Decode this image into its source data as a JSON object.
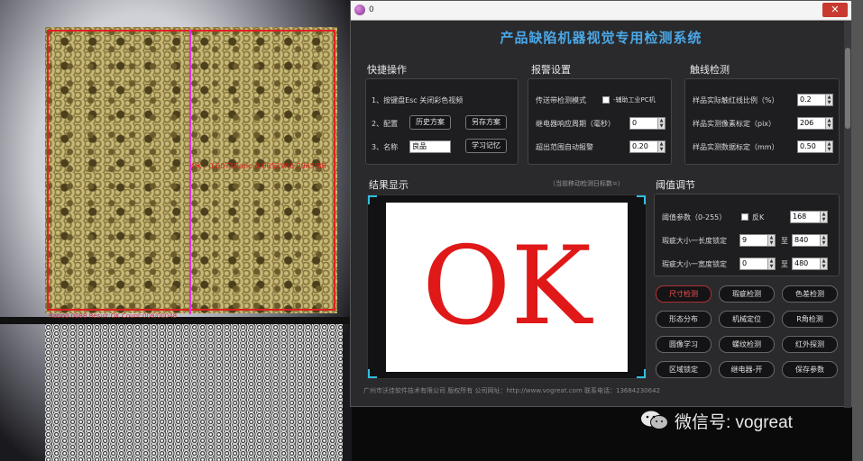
{
  "camera": {
    "readout": "OK - 0.0071Ratio:0.0052W:0.0045/88",
    "caption": "Ratio0.0088 Result:OK Count:008/00048"
  },
  "window": {
    "title": "0",
    "close_label": "✕",
    "header": "产品缺陷机器视觉专用检测系统"
  },
  "quick": {
    "label": "快捷操作",
    "line1": "1、按键盘Esc 关闭彩色视频",
    "line2": "2、配置",
    "history_btn": "历史方案",
    "saveas_btn": "另存方案",
    "line3": "3、名称",
    "name_value": "良品",
    "learn_btn": "学习记忆"
  },
  "alarm": {
    "label": "报警设置",
    "conveyor": "传送带检测模式",
    "ind_pc": "-辅助工业PC机",
    "relay": "继电器响应周期（毫秒）",
    "relay_value": "0",
    "overrange": "超出范围自动报警",
    "overrange_value": "0.20"
  },
  "touch": {
    "label": "触线检测",
    "ratio": "样品实际触红线比例（%）",
    "ratio_value": "0.2",
    "pix": "样品实测像素标定（pix）",
    "pix_value": "206",
    "mm": "样品实测数据标定（mm）",
    "mm_value": "0.50"
  },
  "result": {
    "label": "结果显示",
    "hint": "（当前移动检测日标数=）",
    "text": "OK"
  },
  "threshold": {
    "label": "阈值调节",
    "param": "阈值参数（0-255）",
    "invert": "反K",
    "param_value": "168",
    "long": "瑕疵大小一长度锁定",
    "long_min": "9",
    "long_to": "至",
    "long_max": "840",
    "wide": "瑕疵大小一宽度锁定",
    "wide_min": "0",
    "wide_to": "至",
    "wide_max": "480"
  },
  "buttons": [
    "尺寸检测",
    "瑕疵检测",
    "色差检测",
    "形态分布",
    "机械定位",
    "R角检测",
    "圆像学习",
    "螺纹检测",
    "红外探测",
    "区域锁定",
    "继电器-开",
    "保存参数"
  ],
  "footer": "广州市沃佳软件技术有限公司  版权所有  公司网址：http://www.vogreat.com  联系电话：13684230642",
  "watermark": "微信号: vogreat",
  "colors": {
    "accent": "#4aa8e8",
    "ok": "#e01818",
    "frame_corner": "#30c0e0"
  }
}
